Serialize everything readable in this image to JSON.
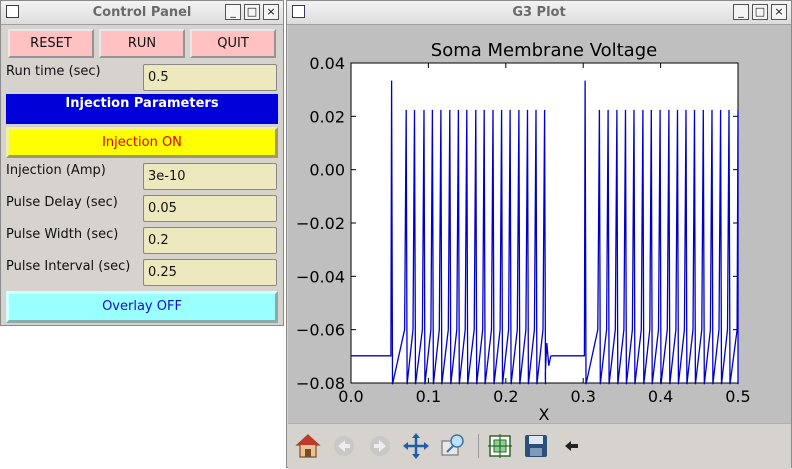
{
  "control_panel": {
    "title": "Control Panel",
    "buttons": {
      "reset": "RESET",
      "run": "RUN",
      "quit": "QUIT"
    },
    "run_time": {
      "label": "Run time (sec)",
      "value": "0.5"
    },
    "injection_header": "Injection Parameters",
    "injection_toggle": "Injection ON",
    "injection_amp": {
      "label": "Injection (Amp)",
      "value": "3e-10"
    },
    "pulse_delay": {
      "label": "Pulse Delay (sec)",
      "value": "0.05"
    },
    "pulse_width": {
      "label": "Pulse Width (sec)",
      "value": "0.2"
    },
    "pulse_interval": {
      "label": "Pulse Interval (sec)",
      "value": "0.25"
    },
    "overlay_toggle": "Overlay OFF"
  },
  "plot_window": {
    "title": "G3 Plot"
  },
  "window_controls": {
    "minimize": "_",
    "maximize": "□",
    "close": "×"
  },
  "toolbar_icons": [
    "home-icon",
    "back-icon",
    "forward-icon",
    "pan-icon",
    "zoom-icon",
    "configure-icon",
    "save-icon",
    "cursor-icon"
  ],
  "colors": {
    "series": "#0000cc",
    "inj_header": "#0000d8",
    "inj_toggle": "#ffff00",
    "overlay": "#99ffff",
    "buttons": "#ffc1c1",
    "entry": "#eee8bf"
  },
  "chart_data": {
    "type": "line",
    "title": "Soma Membrane Voltage",
    "xlabel": "X",
    "ylabel": "",
    "xlim": [
      0.0,
      0.5
    ],
    "ylim": [
      -0.08,
      0.04
    ],
    "xticks": [
      "0.0",
      "0.1",
      "0.2",
      "0.3",
      "0.4",
      "0.5"
    ],
    "xtick_values": [
      0.0,
      0.1,
      0.2,
      0.3,
      0.4,
      0.5
    ],
    "yticks": [
      "0.04",
      "0.02",
      "0.00",
      "−0.02",
      "−0.04",
      "−0.06",
      "−0.08"
    ],
    "ytick_values": [
      0.04,
      0.02,
      0.0,
      -0.02,
      -0.04,
      -0.06,
      -0.08
    ],
    "grid": false,
    "series": [
      {
        "color": "#0000cc",
        "rest_v": -0.0698,
        "trough_v": -0.0805,
        "peak_v": 0.0224,
        "first_peak_v": 0.0334,
        "spike_times": [
          0.0516,
          0.0705,
          0.0813,
          0.0935,
          0.1044,
          0.1153,
          0.1269,
          0.1379,
          0.1488,
          0.1604,
          0.1713,
          0.1827,
          0.1938,
          0.2048,
          0.2161,
          0.2272,
          0.2382,
          0.2493,
          0.3016,
          0.3201,
          0.3314,
          0.3427,
          0.3538,
          0.3648,
          0.3763,
          0.3872,
          0.3985,
          0.4099,
          0.421,
          0.432,
          0.443,
          0.4544,
          0.4656,
          0.4767,
          0.4876,
          0.5
        ],
        "ringing": [
          [
            0.251,
            -0.0765
          ],
          [
            0.253,
            -0.065
          ],
          [
            0.2555,
            -0.0735
          ],
          [
            0.258,
            -0.07
          ],
          [
            0.26,
            -0.0698
          ]
        ]
      }
    ]
  }
}
